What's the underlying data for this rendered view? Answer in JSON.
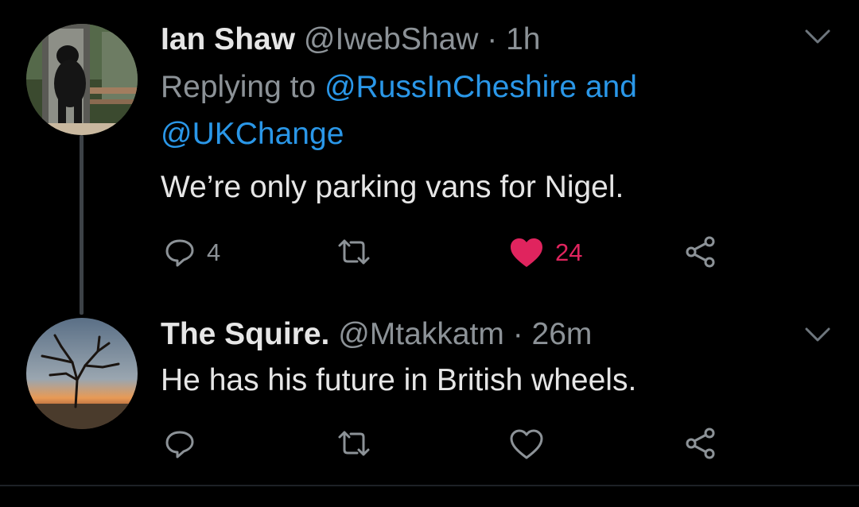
{
  "tweets": [
    {
      "name": "Ian Shaw",
      "handle": "@IwebShaw",
      "separator": "·",
      "time": "1h",
      "replying_prefix": "Replying to",
      "replying_to_1": "@RussInCheshire",
      "replying_and": "and",
      "replying_to_2": "@UKChange",
      "text": "We’re only parking vans for Nigel.",
      "reply_count": "4",
      "retweet_count": "",
      "like_count": "24",
      "liked": true,
      "avatar_icon": "bear-at-door-photo"
    },
    {
      "name": "The Squire.",
      "handle": "@Mtakkatm",
      "separator": "·",
      "time": "26m",
      "text": "He has his future in British wheels.",
      "reply_count": "",
      "retweet_count": "",
      "like_count": "",
      "liked": false,
      "avatar_icon": "bare-tree-sunset-photo"
    }
  ],
  "icons": {
    "reply": "reply-icon",
    "retweet": "retweet-icon",
    "like": "heart-icon",
    "share": "share-icon",
    "menu": "chevron-down-icon"
  },
  "colors": {
    "background": "#000000",
    "mention": "#2a97e8",
    "like": "#e0245e",
    "muted": "#8c9297",
    "text": "#e6e6e6"
  }
}
